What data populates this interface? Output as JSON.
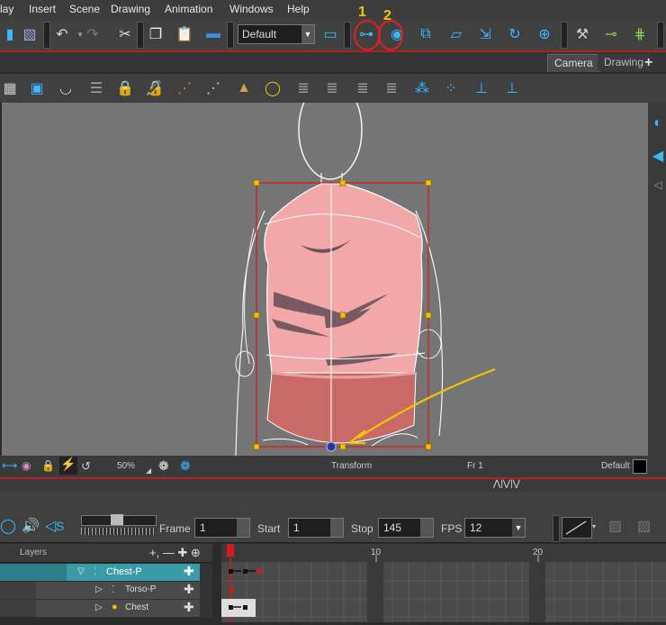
{
  "menu": [
    "lay",
    "Insert",
    "Scene",
    "Drawing",
    "Animation",
    "Windows",
    "Help"
  ],
  "annotations": {
    "circle1": "1",
    "circle2": "2"
  },
  "toolbar": {
    "preset_dropdown": "Default"
  },
  "view_tabs": [
    "Camera",
    "Drawing"
  ],
  "view_tabs_add": "+",
  "status": {
    "zoom": "50%",
    "tool": "Transform",
    "frame": "Fr 1",
    "mode": "Default"
  },
  "playback": {
    "frame_label": "Frame",
    "frame": "1",
    "start_label": "Start",
    "start": "1",
    "stop_label": "Stop",
    "stop": "145",
    "fps_label": "FPS",
    "fps": "12",
    "sound_label": "S"
  },
  "layers": {
    "header": "Layers",
    "header_tools": "+, — ✚ ⊕",
    "rows": [
      {
        "name": "Chest-P",
        "selected": true
      },
      {
        "name": "Torso-P",
        "selected": false
      },
      {
        "name": "Chest",
        "selected": false
      }
    ]
  },
  "timeline": {
    "ticks": [
      "10",
      "20"
    ]
  },
  "colors": {
    "accent": "#3ab8ff",
    "selection": "#d41a1a",
    "annotation": "#e02020",
    "arrow": "#f5c400",
    "layer_selected": "#3a9aa8"
  }
}
